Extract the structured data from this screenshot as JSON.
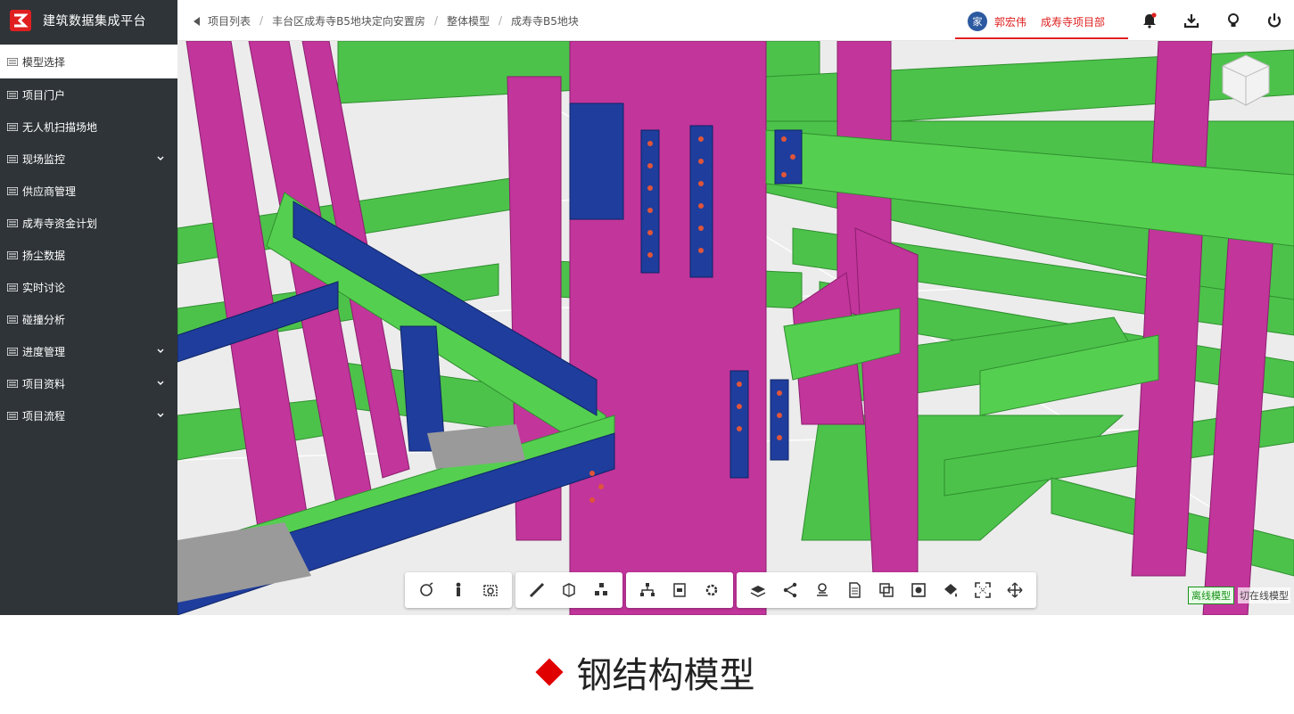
{
  "sidebar": {
    "brand_title": "建筑数据集成平台",
    "items": [
      {
        "label": "模型选择",
        "active": true,
        "expandable": false
      },
      {
        "label": "项目门户",
        "active": false,
        "expandable": false
      },
      {
        "label": "无人机扫描场地",
        "active": false,
        "expandable": false
      },
      {
        "label": "现场监控",
        "active": false,
        "expandable": true
      },
      {
        "label": "供应商管理",
        "active": false,
        "expandable": false
      },
      {
        "label": "成寿寺资金计划",
        "active": false,
        "expandable": false
      },
      {
        "label": "扬尘数据",
        "active": false,
        "expandable": false
      },
      {
        "label": "实时讨论",
        "active": false,
        "expandable": false
      },
      {
        "label": "碰撞分析",
        "active": false,
        "expandable": false
      },
      {
        "label": "进度管理",
        "active": false,
        "expandable": true
      },
      {
        "label": "项目资料",
        "active": false,
        "expandable": true
      },
      {
        "label": "项目流程",
        "active": false,
        "expandable": true
      }
    ]
  },
  "header": {
    "breadcrumb": [
      "项目列表",
      "丰台区成寿寺B5地块定向安置房",
      "整体模型",
      "成寿寺B5地块"
    ],
    "user_name": "郭宏伟",
    "avatar_text": "家",
    "project_name": "成寿寺项目部",
    "icons": [
      "bell-icon",
      "download-icon",
      "lightbulb-icon",
      "power-icon"
    ]
  },
  "toolbar": {
    "groups": [
      [
        "orbit-icon",
        "person-icon",
        "camera-icon"
      ],
      [
        "measure-icon",
        "section-box-icon",
        "explode-icon"
      ],
      [
        "tree-icon",
        "properties-icon",
        "settings-icon"
      ],
      [
        "layers-icon",
        "share-icon",
        "map-pin-icon",
        "document-icon",
        "copy-icon",
        "record-icon",
        "paint-icon",
        "fullscreen-icon",
        "move-icon"
      ]
    ]
  },
  "mode": {
    "offline_label": "离线模型",
    "online_label": "切在线模型"
  },
  "caption": {
    "text": "钢结构模型"
  },
  "colors": {
    "sidebar_bg": "#2f3438",
    "accent_red": "#e02020",
    "steel_green": "#4cc24a",
    "steel_magenta": "#c2359b",
    "steel_blue": "#1f3d9c"
  }
}
